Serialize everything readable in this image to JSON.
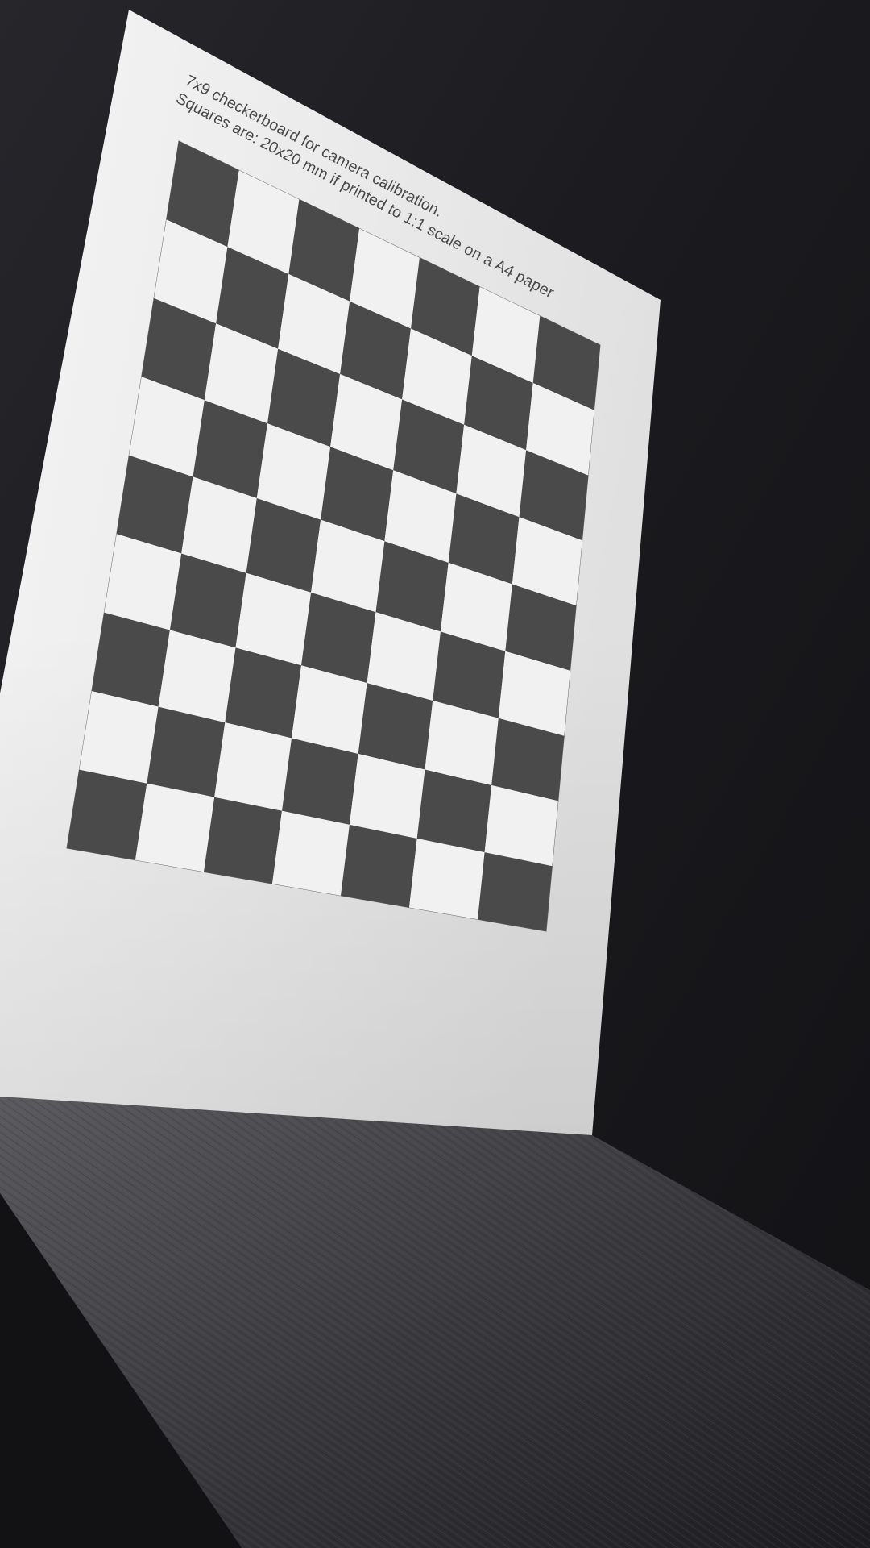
{
  "paper": {
    "line1": "7x9 checkerboard for camera calibration.",
    "line2": "Squares are: 20x20 mm if printed to 1:1 scale on a A4 paper"
  },
  "board": {
    "cols": 7,
    "rows": 9,
    "dark_color": "#4a4a4a",
    "light_color": "#f1f1f1"
  },
  "colors": {
    "desk": "#1c1c20",
    "paper": "#e9e9e9"
  }
}
